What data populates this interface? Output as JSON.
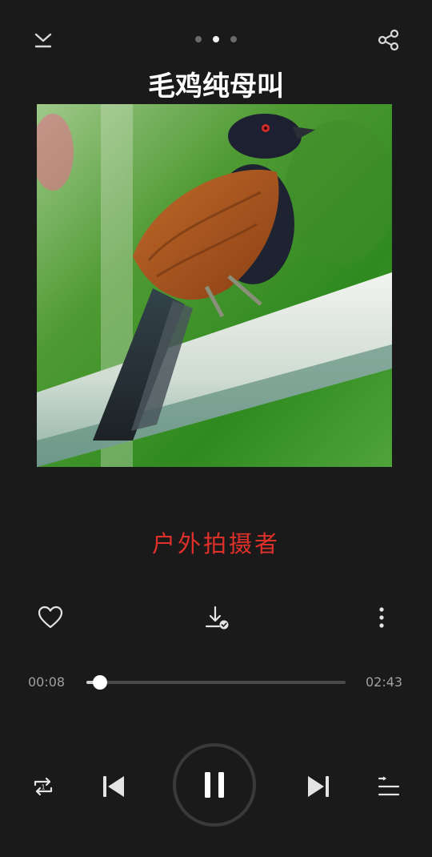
{
  "header": {
    "title": "毛鸡纯母叫",
    "pages": 3,
    "active_page": 2
  },
  "icons": {
    "collapse": "chevron-down-bar-icon",
    "share": "share-icon",
    "like": "heart-outline-icon",
    "download": "download-check-icon",
    "more": "more-vertical-icon",
    "repeat": "repeat-one-icon",
    "prev": "skip-previous-icon",
    "pause": "pause-icon",
    "next": "skip-next-icon",
    "playlist": "playlist-icon"
  },
  "artwork": {
    "subject": "coucal bird perched on a white pipe",
    "artist": "户外拍摄者"
  },
  "progress": {
    "current": "00:08",
    "total": "02:43",
    "fraction": 0.054
  },
  "playback": {
    "state": "playing"
  },
  "colors": {
    "background": "#1a1a1a",
    "artist_text": "#e0302a",
    "accent": "#ffffff"
  }
}
